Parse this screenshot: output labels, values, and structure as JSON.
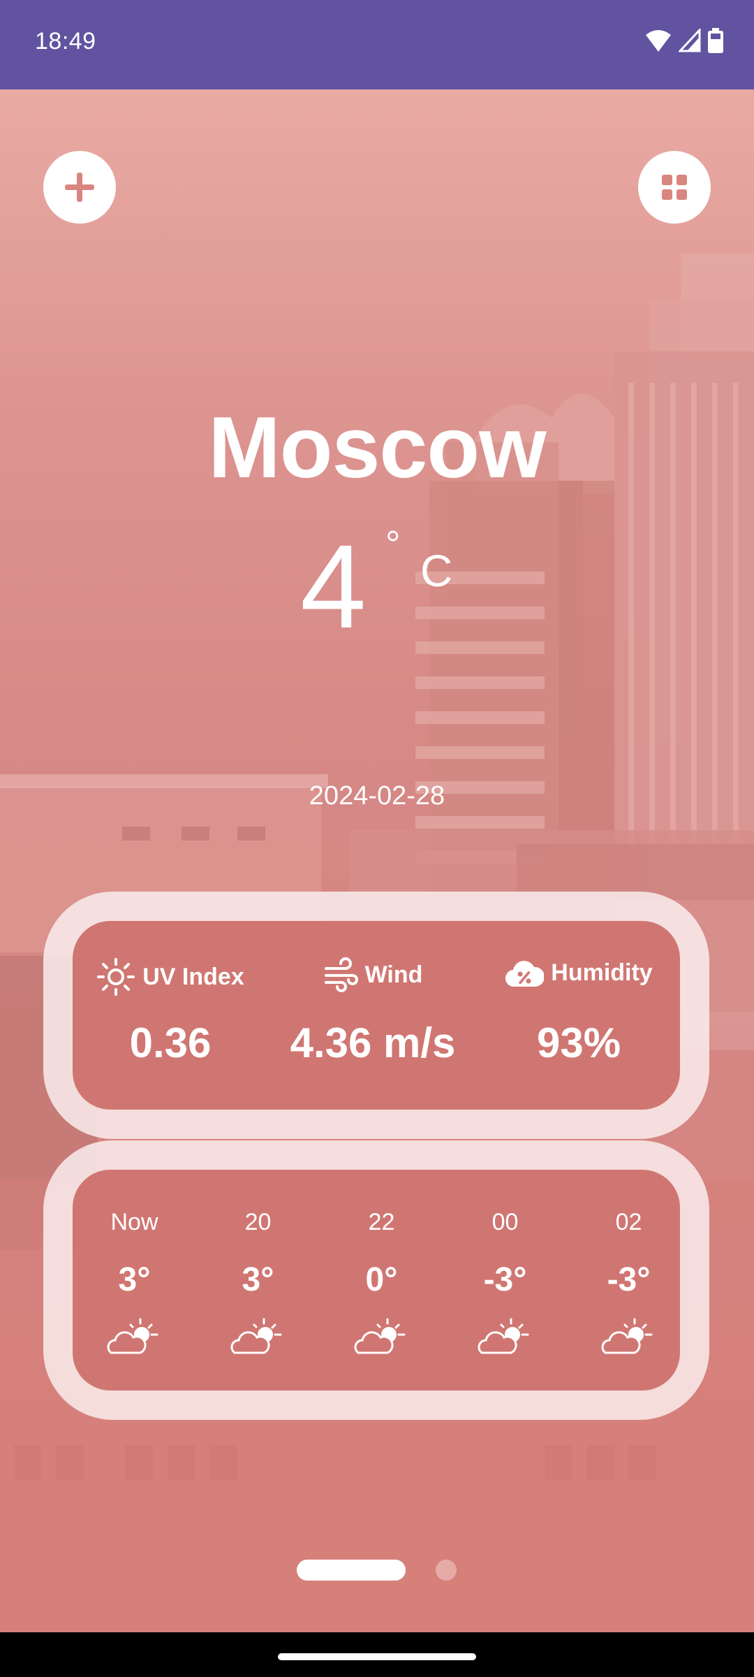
{
  "status_bar": {
    "time": "18:49"
  },
  "header": {
    "add_button_icon": "plus-icon",
    "grid_button_icon": "grid-icon"
  },
  "weather": {
    "city": "Moscow",
    "temperature": "4",
    "degree_symbol": "°",
    "unit": "C",
    "date": "2024-02-28"
  },
  "stats": [
    {
      "label": "UV Index",
      "value": "0.36",
      "icon": "sun-icon"
    },
    {
      "label": "Wind",
      "value": "4.36 m/s",
      "icon": "wind-icon"
    },
    {
      "label": "Humidity",
      "value": "93%",
      "icon": "cloud-percent-icon"
    }
  ],
  "hourly": [
    {
      "time": "Now",
      "temp": "3°",
      "icon": "partly-cloudy-icon"
    },
    {
      "time": "20",
      "temp": "3°",
      "icon": "partly-cloudy-icon"
    },
    {
      "time": "22",
      "temp": "0°",
      "icon": "partly-cloudy-icon"
    },
    {
      "time": "00",
      "temp": "-3°",
      "icon": "partly-cloudy-icon"
    },
    {
      "time": "02",
      "temp": "-3°",
      "icon": "partly-cloudy-icon"
    }
  ],
  "pager": {
    "pages": 2,
    "active_index": 0
  },
  "colors": {
    "status_bar": "#6153a0",
    "card_inner": "#d07672",
    "card_outer": "#faecec",
    "accent": "#d98680"
  }
}
